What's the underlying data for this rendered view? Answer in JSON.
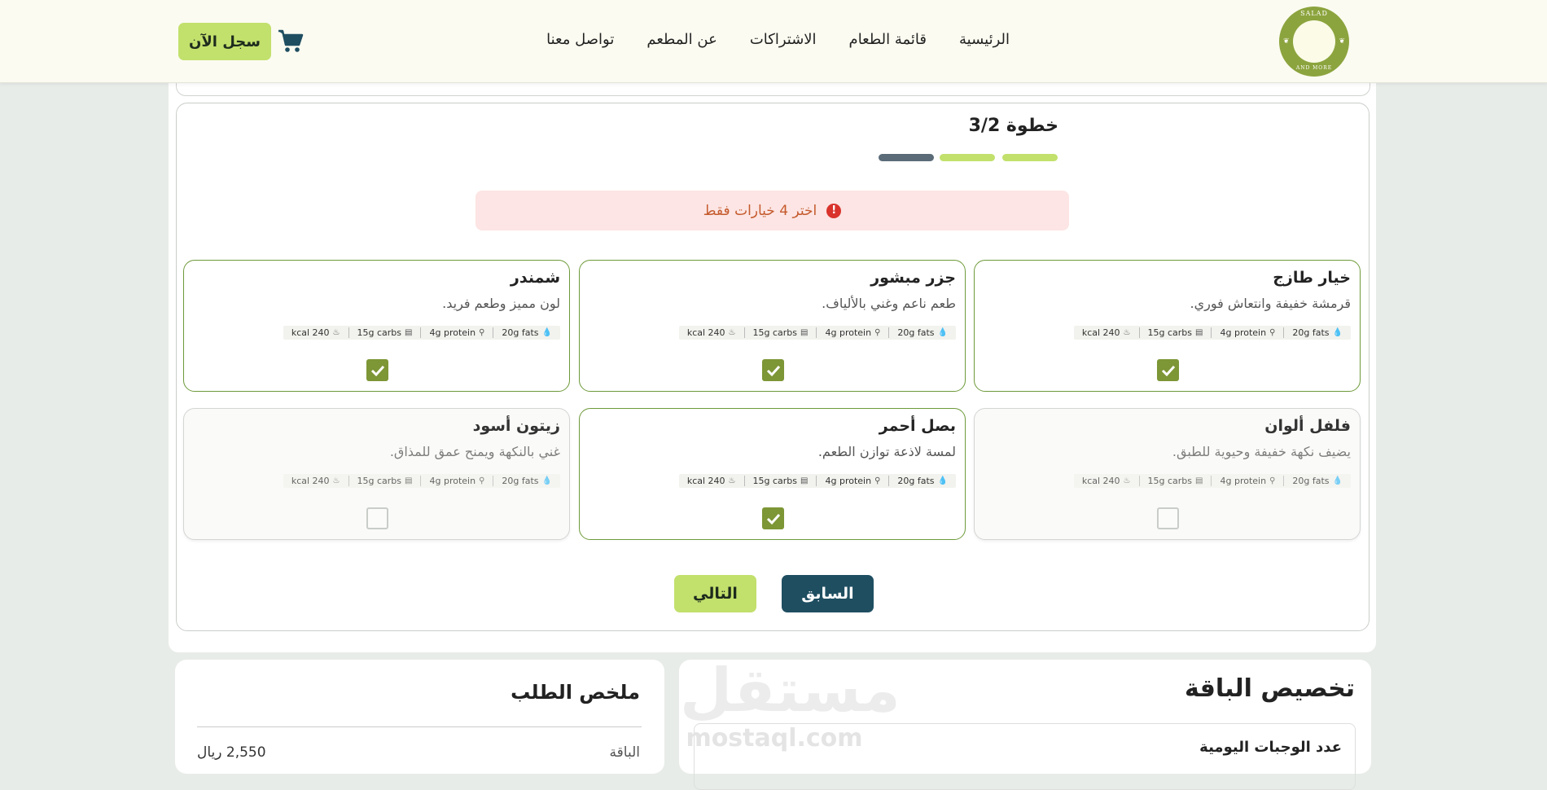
{
  "header": {
    "logo_top_text": "SALAD",
    "logo_bottom_text": "AND MORE",
    "nav": [
      "الرئيسية",
      "قائمة الطعام",
      "الاشتراكات",
      "عن المطعم",
      "تواصل معنا"
    ],
    "register_label": "سجل الآن"
  },
  "step": {
    "title": "خطوة 3/2",
    "progress": [
      {
        "state": "done",
        "color": "#c2e06c"
      },
      {
        "state": "current",
        "color": "#c2e06c"
      },
      {
        "state": "pending",
        "color": "#5b6b78"
      }
    ],
    "alert": "اختر 4 خيارات فقط",
    "alert_color": "#c55a2d"
  },
  "options": [
    {
      "title": "خيار طازج",
      "desc": "قرمشة خفيفة وانتعاش فوري.",
      "fats": "20g fats",
      "protein": "4g protein",
      "carbs": "15g carbs",
      "kcal": "240 kcal",
      "selected": true
    },
    {
      "title": "جزر مبشور",
      "desc": "طعم ناعم وغني بالألياف.",
      "fats": "20g fats",
      "protein": "4g protein",
      "carbs": "15g carbs",
      "kcal": "240 kcal",
      "selected": true
    },
    {
      "title": "شمندر",
      "desc": "لون مميز وطعم فريد.",
      "fats": "20g fats",
      "protein": "4g protein",
      "carbs": "15g carbs",
      "kcal": "240 kcal",
      "selected": true
    },
    {
      "title": "فلفل ألوان",
      "desc": "يضيف نكهة خفيفة وحيوية للطبق.",
      "fats": "20g fats",
      "protein": "4g protein",
      "carbs": "15g carbs",
      "kcal": "240 kcal",
      "selected": false
    },
    {
      "title": "بصل أحمر",
      "desc": "لمسة لاذعة توازن الطعم.",
      "fats": "20g fats",
      "protein": "4g protein",
      "carbs": "15g carbs",
      "kcal": "240 kcal",
      "selected": true
    },
    {
      "title": "زيتون أسود",
      "desc": "غني بالنكهة ويمنح عمق للمذاق.",
      "fats": "20g fats",
      "protein": "4g protein",
      "carbs": "15g carbs",
      "kcal": "240 kcal",
      "selected": false
    }
  ],
  "buttons": {
    "prev_label": "السابق",
    "next_label": "التالي"
  },
  "summary": {
    "title": "ملخص الطلب",
    "package_label": "الباقة",
    "package_value": "2,550 ريال"
  },
  "customize": {
    "title": "تخصيص الباقة",
    "meals_label": "عدد الوجبات اليومية"
  },
  "watermark": {
    "main": "مستقل",
    "sub": "mostaql.com"
  },
  "colors": {
    "accent_green": "#c2e06c",
    "dark_teal": "#1f4e61",
    "check_green": "#7d9636",
    "selected_border": "#6e9a3a"
  }
}
